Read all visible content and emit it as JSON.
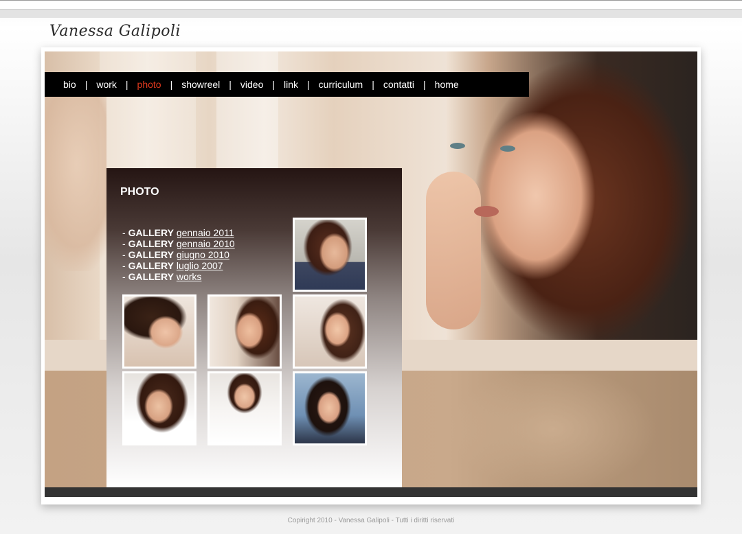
{
  "site": {
    "logo_text": "Vanessa Galipoli"
  },
  "nav": {
    "items": [
      {
        "label": "bio"
      },
      {
        "label": "work"
      },
      {
        "label": "photo",
        "active": true
      },
      {
        "label": "showreel"
      },
      {
        "label": "video"
      },
      {
        "label": "link"
      },
      {
        "label": "curriculum"
      },
      {
        "label": "contatti"
      },
      {
        "label": "home"
      }
    ],
    "separator": "|",
    "active_color": "#e03a1e"
  },
  "main": {
    "title": "PHOTO",
    "galleries": [
      {
        "prefix": "- ",
        "label": "GALLERY",
        "link": "gennaio 2011"
      },
      {
        "prefix": "- ",
        "label": "GALLERY",
        "link": "gennaio 2010"
      },
      {
        "prefix": "- ",
        "label": "GALLERY",
        "link": "giugno 2010"
      },
      {
        "prefix": "- ",
        "label": "GALLERY",
        "link": "luglio 2007"
      },
      {
        "prefix": "- ",
        "label": "GALLERY",
        "link": "works"
      }
    ],
    "thumbnails_count": 7
  },
  "footer": {
    "copyright": "Copiright 2010 - Vanessa Galipoli - Tutti i diritti riservati"
  }
}
